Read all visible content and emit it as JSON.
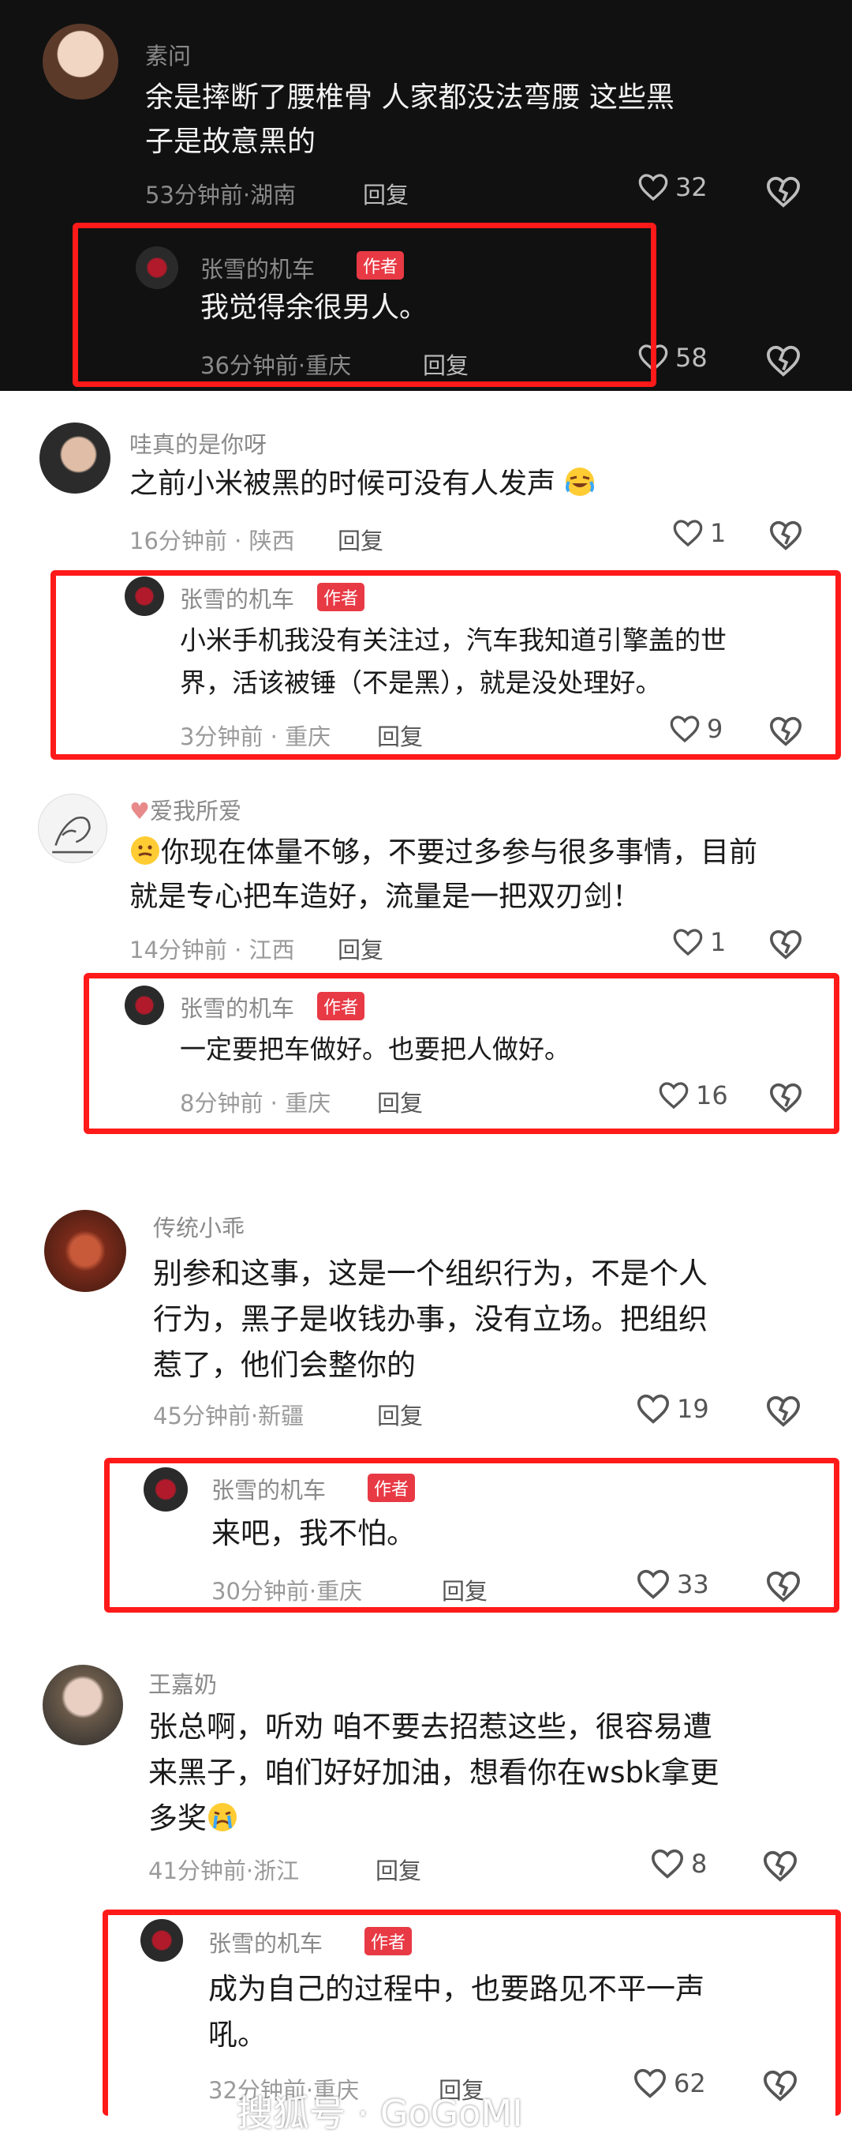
{
  "colors": {
    "dark_bg": "#111111",
    "highlight": "#ff1a1a",
    "badge": "#e83a45"
  },
  "author_badge": "作者",
  "comments": [
    {
      "user": "素问",
      "text_lines": [
        "余是摔断了腰椎骨  人家都没法弯腰   这些黑",
        "子是故意黑的"
      ],
      "time": "53分钟前·湖南",
      "reply": "回复",
      "likes": "32",
      "author_reply": {
        "user": "张雪的机车",
        "text_lines": [
          "我觉得余很男人。"
        ],
        "time": "36分钟前·重庆",
        "reply": "回复",
        "likes": "58"
      }
    },
    {
      "user": "哇真的是你呀",
      "text_lines": [
        "之前小米被黑的时候可没有人发声"
      ],
      "time": "16分钟前 · 陕西",
      "reply": "回复",
      "likes": "1",
      "author_reply": {
        "user": "张雪的机车",
        "text_lines": [
          "小米手机我没有关注过，汽车我知道引擎盖的世",
          "界，活该被锤（不是黑），就是没处理好。"
        ],
        "time": "3分钟前 · 重庆",
        "reply": "回复",
        "likes": "9"
      }
    },
    {
      "user": "爱我所爱",
      "text_lines": [
        "你现在体量不够，不要过多参与很多事情，目前",
        "就是专心把车造好，流量是一把双刃剑！"
      ],
      "time": "14分钟前 · 江西",
      "reply": "回复",
      "likes": "1",
      "author_reply": {
        "user": "张雪的机车",
        "text_lines": [
          "一定要把车做好。也要把人做好。"
        ],
        "time": "8分钟前 · 重庆",
        "reply": "回复",
        "likes": "16"
      }
    },
    {
      "user": "传统小乖",
      "text_lines": [
        "别参和这事，这是一个组织行为，不是个人",
        "行为，黑子是收钱办事，没有立场。把组织",
        "惹了，他们会整你的"
      ],
      "time": "45分钟前·新疆",
      "reply": "回复",
      "likes": "19",
      "author_reply": {
        "user": "张雪的机车",
        "text_lines": [
          "来吧，我不怕。"
        ],
        "time": "30分钟前·重庆",
        "reply": "回复",
        "likes": "33"
      }
    },
    {
      "user": "王嘉奶",
      "text_lines": [
        "张总啊，听劝  咱不要去招惹这些，很容易遭",
        "来黑子，咱们好好加油，想看你在wsbk拿更",
        "多奖"
      ],
      "time": "41分钟前·浙江",
      "reply": "回复",
      "likes": "8",
      "author_reply": {
        "user": "张雪的机车",
        "text_lines": [
          "成为自己的过程中，也要路见不平一声",
          "吼。"
        ],
        "time": "32分钟前·重庆",
        "reply": "回复",
        "likes": "62"
      }
    }
  ],
  "watermark": "搜狐号 · GoGoMI"
}
